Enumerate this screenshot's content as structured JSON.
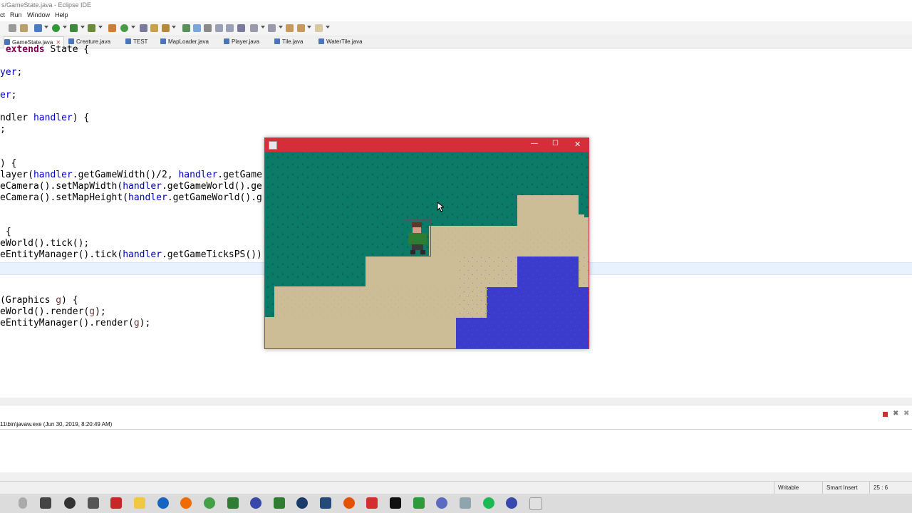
{
  "window": {
    "title": "s/GameState.java - Eclipse IDE"
  },
  "menu": [
    "ct",
    "Run",
    "Window",
    "Help"
  ],
  "tabs": [
    {
      "label": "GameState.java",
      "active": true
    },
    {
      "label": "Creature.java"
    },
    {
      "label": "TEST"
    },
    {
      "label": "MapLoader.java"
    },
    {
      "label": "Player.java"
    },
    {
      "label": "Tile.java"
    },
    {
      "label": "WaterTile.java"
    }
  ],
  "editor": {
    "lines": [
      " extends State {",
      "",
      "yer;",
      "",
      "er;",
      "",
      "ndler handler) {",
      ";",
      "",
      "",
      ") {",
      "layer(handler.getGameWidth()/2, handler.getGame",
      "eCamera().setMapWidth(handler.getGameWorld().ge",
      "eCamera().setMapHeight(handler.getGameWorld().g",
      "",
      "",
      " {",
      "eWorld().tick();",
      "eEntityManager().tick(handler.getGameTicksPS())",
      "",
      "",
      "",
      "(Graphics g) {",
      "eWorld().render(g);",
      "eEntityManager().render(g);"
    ]
  },
  "console": {
    "path": "11\\bin\\javaw.exe (Jun 30, 2019, 8:20:49 AM)"
  },
  "status": {
    "writable": "Writable",
    "insert_mode": "Smart Insert",
    "position": "25 : 6"
  },
  "colors": {
    "game_titlebar": "#d62d3a",
    "grass": "#0b7a67",
    "sand": "#cdbd96",
    "water": "#3b3ccb"
  },
  "game": {
    "controls": {
      "minimize": "—",
      "maximize": "☐",
      "close": "✕"
    }
  }
}
